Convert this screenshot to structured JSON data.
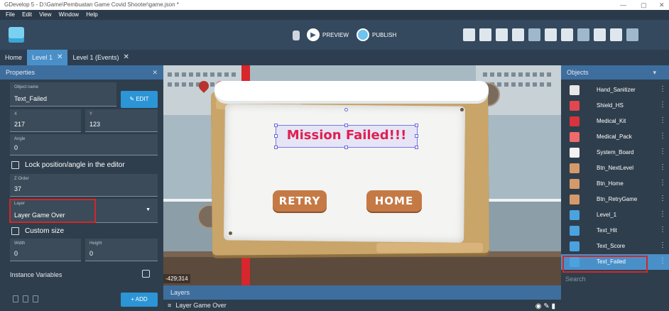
{
  "window": {
    "title": "GDevelop 5 - D:\\Game\\Pembuatan Game Covid Shooter\\game.json *",
    "controls": [
      "—",
      "▢",
      "✕"
    ]
  },
  "menu": [
    "File",
    "Edit",
    "View",
    "Window",
    "Help"
  ],
  "toolbar": {
    "preview_label": "PREVIEW",
    "publish_label": "PUBLISH"
  },
  "tabs": [
    {
      "label": "Home",
      "closable": false
    },
    {
      "label": "Level 1",
      "closable": true
    },
    {
      "label": "Level 1 (Events)",
      "closable": true
    }
  ],
  "properties": {
    "title": "Properties",
    "object_name_label": "Object name",
    "object_name": "Text_Failed",
    "edit_label": "EDIT",
    "x_label": "X",
    "x_value": "217",
    "y_label": "Y",
    "y_value": "123",
    "angle_label": "Angle",
    "angle_value": "0",
    "lock_label": "Lock position/angle in the editor",
    "z_order_label": "Z Order",
    "z_order_value": "37",
    "layer_label": "Layer",
    "layer_value": "Layer Game Over",
    "custom_size_label": "Custom size",
    "width_label": "Width",
    "width_value": "0",
    "height_label": "Height",
    "height_value": "0",
    "instance_variables_label": "Instance Variables",
    "add_label": "+ ADD"
  },
  "scene": {
    "title_text": "Mission Failed!!!",
    "retry_label": "RETRY",
    "home_label": "HOME",
    "coordinates": "-429;314"
  },
  "layers": {
    "title": "Layers",
    "rows": [
      "Layer Game Over"
    ]
  },
  "objects": {
    "title": "Objects",
    "items": [
      {
        "name": "Hand_Sanitizer",
        "icon": "sanitizer-icon",
        "color": "#e7e7e7"
      },
      {
        "name": "Shield_HS",
        "icon": "shield-icon",
        "color": "#e2464f"
      },
      {
        "name": "Medical_Kit",
        "icon": "medkit-icon",
        "color": "#d8343c"
      },
      {
        "name": "Medical_Pack",
        "icon": "medpack-icon",
        "color": "#f06a6a"
      },
      {
        "name": "System_Board",
        "icon": "board-icon",
        "color": "#f2f2f2"
      },
      {
        "name": "Btn_NextLevel",
        "icon": "button-sprite-icon",
        "color": "#d49a6a"
      },
      {
        "name": "Btn_Home",
        "icon": "button-sprite-icon",
        "color": "#d49a6a"
      },
      {
        "name": "Btn_RetryGame",
        "icon": "button-sprite-icon",
        "color": "#d49a6a"
      },
      {
        "name": "Level_1",
        "icon": "text-object-icon",
        "color": "#4aa3df"
      },
      {
        "name": "Text_Hit",
        "icon": "text-object-icon",
        "color": "#4aa3df"
      },
      {
        "name": "Text_Score",
        "icon": "text-object-icon",
        "color": "#4aa3df"
      },
      {
        "name": "Text_Failed",
        "icon": "text-object-icon",
        "color": "#4aa3df"
      }
    ],
    "selected": "Text_Failed",
    "search_placeholder": "Search"
  },
  "colors": {
    "accent": "#4a90c8",
    "highlight": "#d02828",
    "button": "#2b95d6"
  }
}
